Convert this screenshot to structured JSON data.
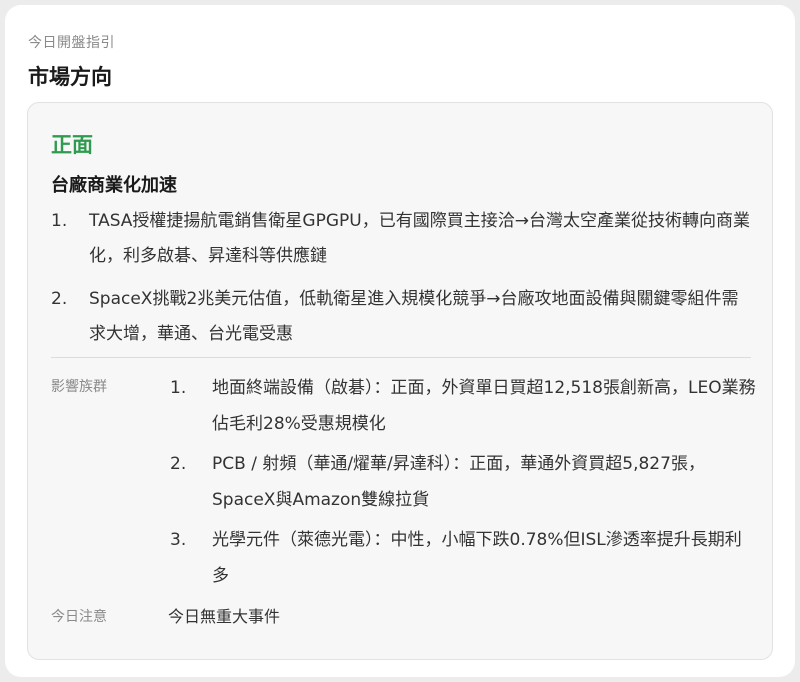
{
  "header": {
    "eyebrow": "今日開盤指引",
    "title": "市場方向"
  },
  "summary": {
    "sentiment": "正面",
    "sentiment_color": "#2e9b50",
    "headline": "台廠商業化加速",
    "points": [
      {
        "num": "1.",
        "text": "TASA授權捷揚航電銷售衛星GPGPU，已有國際買主接洽→台灣太空產業從技術轉向商業化，利多啟碁、昇達科等供應鏈"
      },
      {
        "num": "2.",
        "text": "SpaceX挑戰2兆美元估值，低軌衛星進入規模化競爭→台廠攻地面設備與關鍵零組件需求大增，華通、台光電受惠"
      }
    ]
  },
  "impact": {
    "label": "影響族群",
    "items": [
      {
        "num": "1.",
        "text": "地面終端設備（啟碁）：正面，外資單日買超12,518張創新高，LEO業務佔毛利28%受惠規模化"
      },
      {
        "num": "2.",
        "text": "PCB / 射頻（華通/燿華/昇達科）：正面，華通外資買超5,827張，SpaceX與Amazon雙線拉貨"
      },
      {
        "num": "3.",
        "text": "光學元件（萊德光電）：中性，小幅下跌0.78%但ISL滲透率提升長期利多"
      }
    ]
  },
  "notice": {
    "label": "今日注意",
    "text": "今日無重大事件"
  }
}
